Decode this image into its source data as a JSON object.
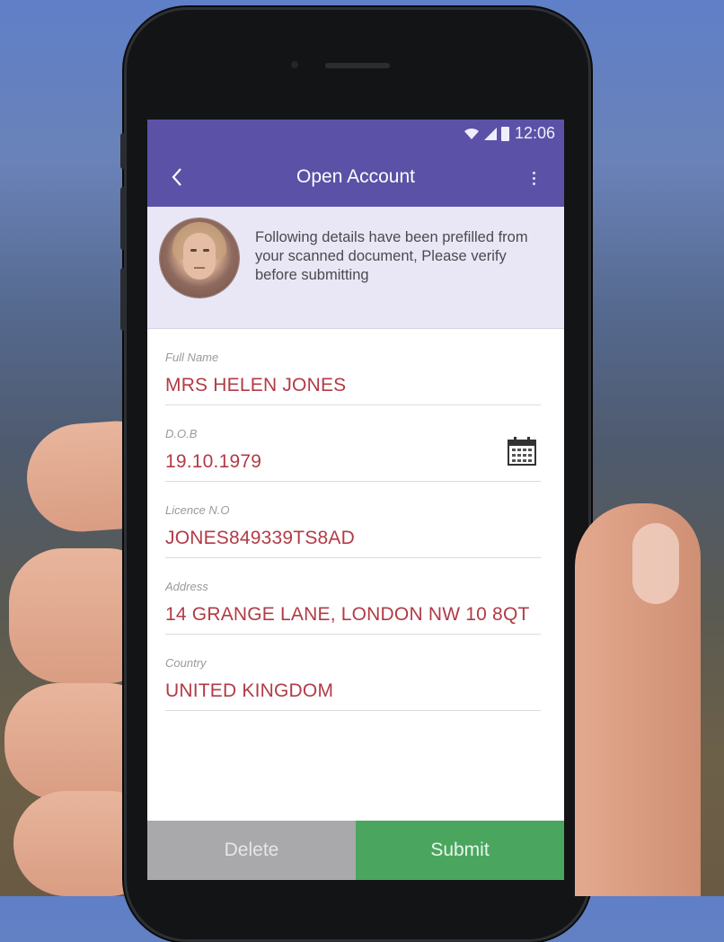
{
  "status_bar": {
    "time": "12:06"
  },
  "app_bar": {
    "title": "Open Account",
    "back_icon": "chevron-left-icon",
    "more_icon": "more-vertical-icon"
  },
  "info": {
    "message": "Following details have been prefilled from your scanned document, Please verify before submitting"
  },
  "fields": [
    {
      "label": "Full Name",
      "value": "MRS HELEN JONES"
    },
    {
      "label": "D.O.B",
      "value": "19.10.1979"
    },
    {
      "label": "Licence N.O",
      "value": "JONES849339TS8AD"
    },
    {
      "label": "Address",
      "value": "14 GRANGE LANE, LONDON NW 10 8QT"
    },
    {
      "label": "Country",
      "value": "UNITED KINGDOM"
    }
  ],
  "actions": {
    "delete_label": "Delete",
    "submit_label": "Submit"
  },
  "colors": {
    "primary": "#5b52a7",
    "value_text": "#b23b46",
    "submit": "#4aa65f",
    "delete": "#a9a9ab",
    "info_bg": "#e9e7f6"
  }
}
